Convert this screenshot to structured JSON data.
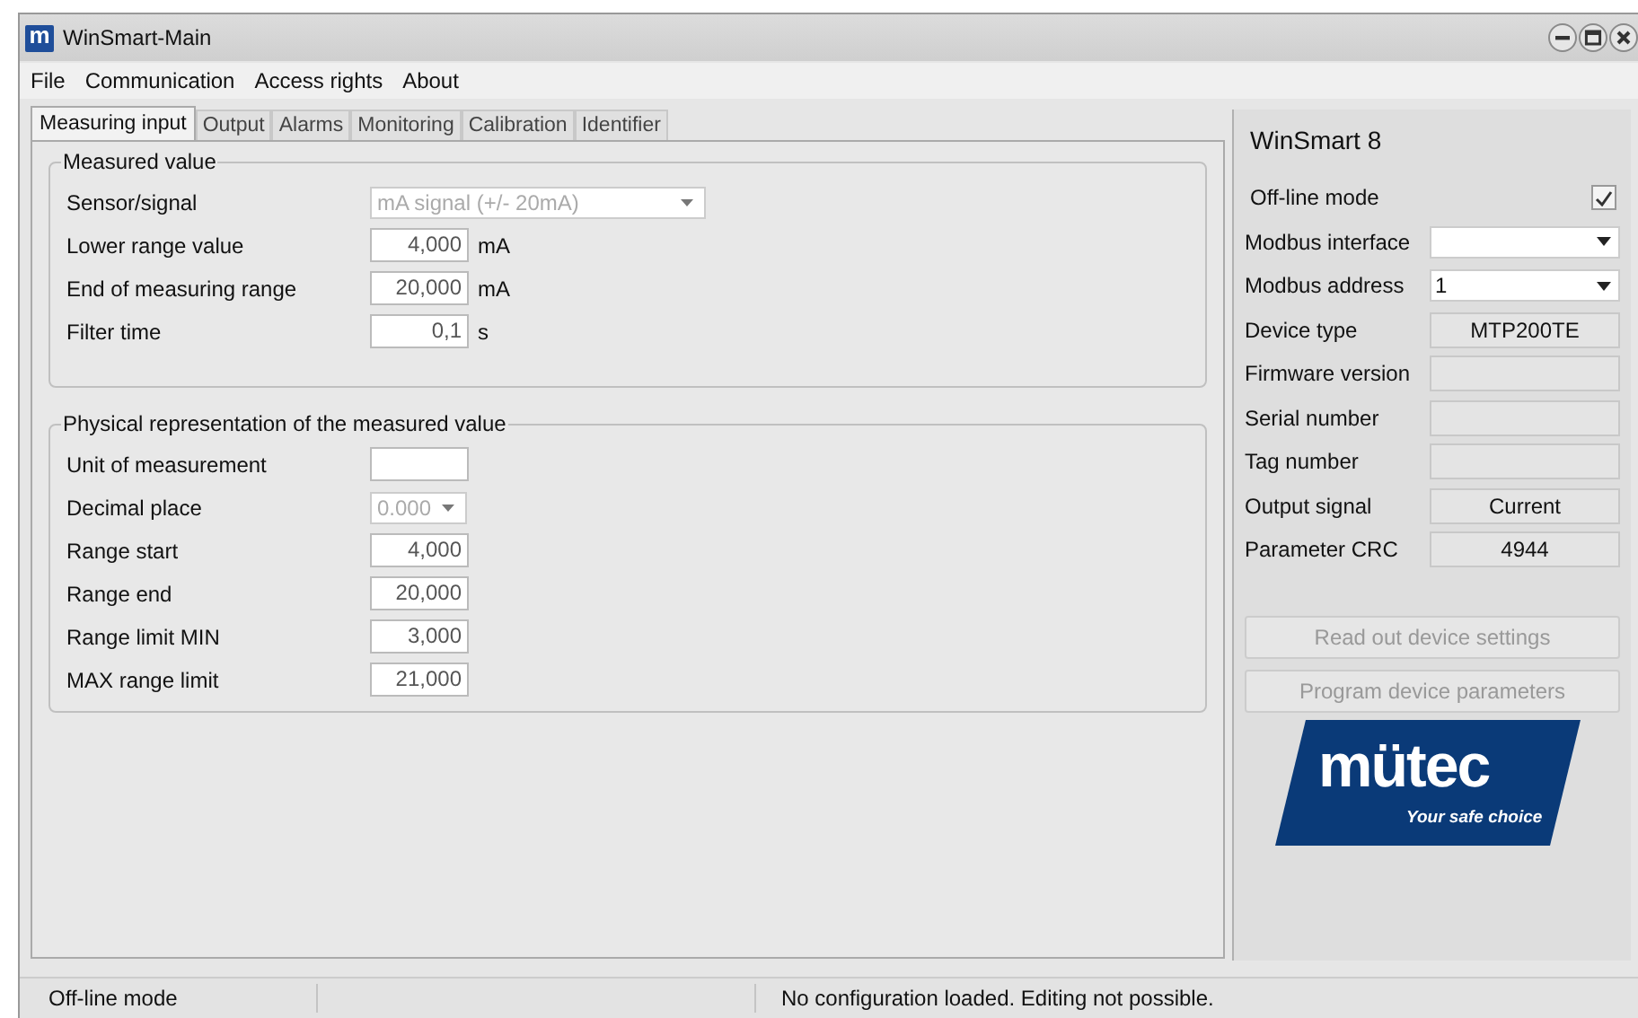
{
  "window": {
    "title": "WinSmart-Main",
    "app_icon_letter": "m"
  },
  "menu": [
    "File",
    "Communication",
    "Access rights",
    "About"
  ],
  "tabs": [
    {
      "label": "Measuring input",
      "selected": true
    },
    {
      "label": "Output",
      "selected": false
    },
    {
      "label": "Alarms",
      "selected": false
    },
    {
      "label": "Monitoring",
      "selected": false
    },
    {
      "label": "Calibration",
      "selected": false
    },
    {
      "label": "Identifier",
      "selected": false
    }
  ],
  "groups": [
    {
      "title": "Measured value",
      "rows": [
        {
          "kind": "select",
          "label": "Sensor/signal",
          "value": "mA signal (+/- 20mA)",
          "disabled": true
        },
        {
          "kind": "input",
          "label": "Lower range value",
          "value": "4,000",
          "unit": "mA",
          "disabled": false
        },
        {
          "kind": "input",
          "label": "End of measuring range",
          "value": "20,000",
          "unit": "mA",
          "disabled": false
        },
        {
          "kind": "input",
          "label": "Filter time",
          "value": "0,1",
          "unit": "s",
          "disabled": false
        }
      ]
    },
    {
      "title": "Physical representation of the measured value",
      "rows": [
        {
          "kind": "input",
          "label": "Unit of measurement",
          "disabled": false
        },
        {
          "kind": "select",
          "label": "Decimal place",
          "value": "0.000",
          "disabled": true
        },
        {
          "kind": "input",
          "label": "Range start",
          "value": "4,000",
          "disabled": false
        },
        {
          "kind": "input",
          "label": "Range end",
          "value": "20,000",
          "disabled": false
        },
        {
          "kind": "input",
          "label": "Range limit MIN",
          "value": "3,000",
          "disabled": false
        },
        {
          "kind": "input",
          "label": "MAX range limit",
          "value": "21,000",
          "disabled": false
        }
      ]
    }
  ],
  "panel": {
    "title": "WinSmart 8",
    "offline": {
      "label": "Off-line mode",
      "checked": true
    },
    "rows": [
      {
        "kind": "select",
        "label": "Modbus interface"
      },
      {
        "kind": "select",
        "label": "Modbus address",
        "value": "1"
      },
      {
        "kind": "readout",
        "label": "Device type",
        "value": "MTP200TE"
      },
      {
        "kind": "readout",
        "label": "Firmware version"
      },
      {
        "kind": "readout",
        "label": "Serial number"
      },
      {
        "kind": "readout",
        "label": "Tag number"
      },
      {
        "kind": "readout",
        "label": "Output signal",
        "value": "Current"
      },
      {
        "kind": "readout",
        "label": "Parameter CRC",
        "value": "4944"
      }
    ],
    "buttons": [
      {
        "label": "Read out device settings",
        "disabled": true
      },
      {
        "label": "Program device parameters",
        "disabled": true
      }
    ],
    "logo": {
      "name": "mütec",
      "tagline": "Your safe choice"
    }
  },
  "status_bar": [
    "Off-line mode",
    "No configuration loaded. Editing not possible."
  ]
}
